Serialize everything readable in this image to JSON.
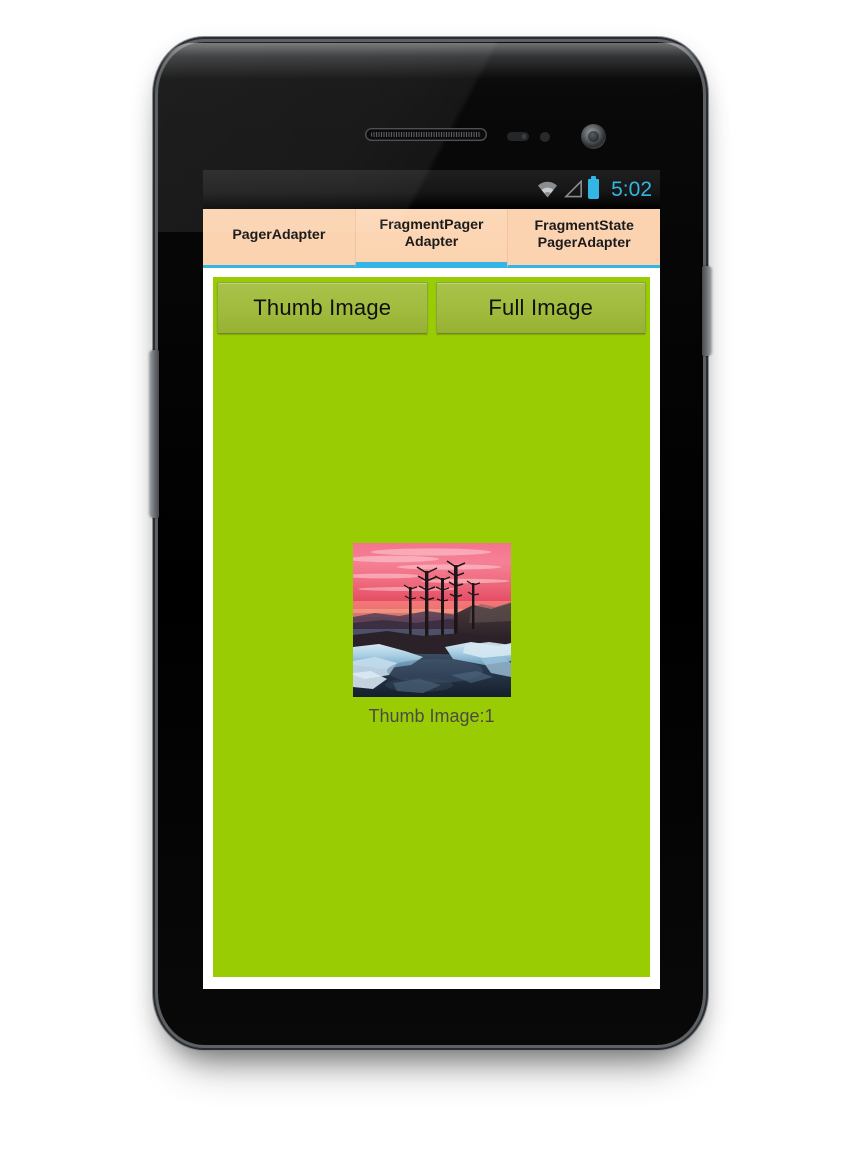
{
  "device": {
    "name": "android-phone",
    "hardware": {
      "earpiece": "earpiece-speaker",
      "front_camera": "front-camera",
      "proximity_sensor": "proximity-sensor",
      "light_sensor": "ambient-light-sensor",
      "volume_rocker": "volume-rocker",
      "power_button": "power-button"
    }
  },
  "status_bar": {
    "clock": "5:02",
    "icons": [
      "wifi-icon",
      "signal-icon",
      "battery-icon"
    ],
    "accent_color": "#33b5e5",
    "background_color": "#161616"
  },
  "tabs": {
    "selected_index": 1,
    "background_color": "#fbd3b0",
    "indicator_color": "#33b5e5",
    "items": [
      {
        "label": "PagerAdapter",
        "name": "tab-pager-adapter"
      },
      {
        "label": "FragmentPager Adapter",
        "name": "tab-fragment-pager-adapter"
      },
      {
        "label": "FragmentState PagerAdapter",
        "name": "tab-fragment-state-pager-adapter"
      }
    ]
  },
  "content": {
    "background_color": "#9acc04",
    "buttons": [
      {
        "label": "Thumb Image",
        "name": "thumb-image-button"
      },
      {
        "label": "Full Image",
        "name": "full-image-button"
      }
    ],
    "image": {
      "name": "thumbnail-photo",
      "alt": "Sunset over a partially frozen lake with silhouetted pine trees",
      "caption": "Thumb Image:1"
    }
  }
}
